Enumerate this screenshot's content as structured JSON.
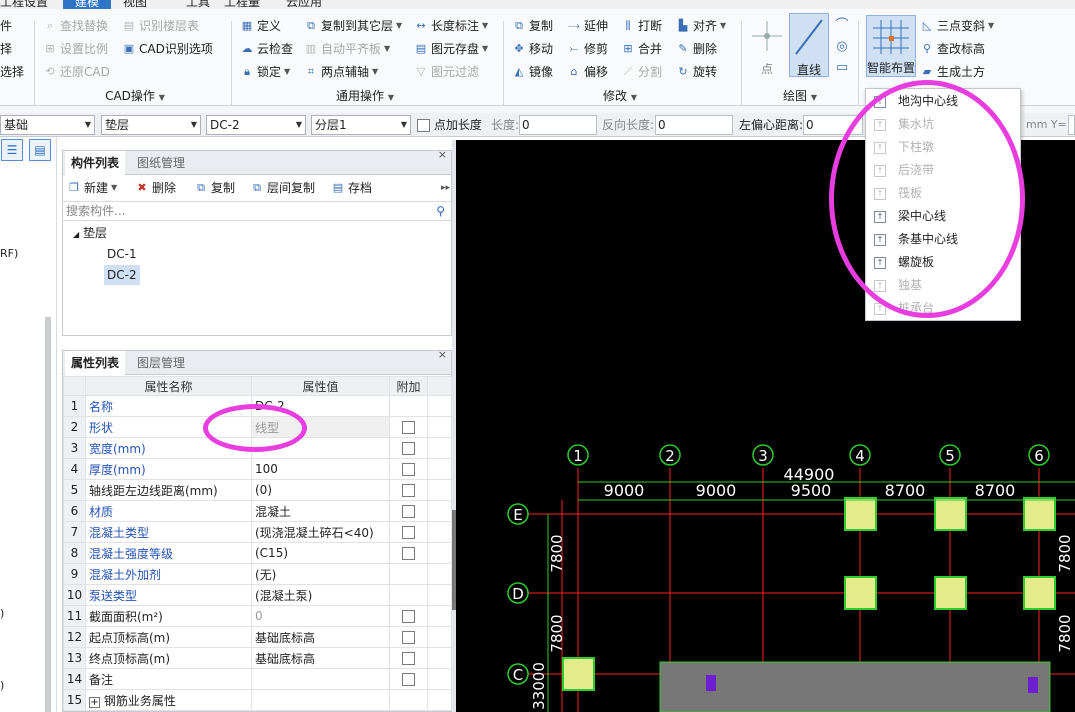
{
  "menu": {
    "tabs": [
      "工程设置",
      "建模",
      "视图",
      "工具",
      "工程量",
      "云应用"
    ],
    "active_index": 1
  },
  "left_edge_fragments": [
    "件",
    "择",
    "选择"
  ],
  "cad_group": {
    "title": "CAD操作",
    "items": [
      "查找替换",
      "识别楼层表",
      "设置比例",
      "CAD识别选项",
      "还原CAD"
    ]
  },
  "general_group": {
    "title": "通用操作",
    "items": [
      "定义",
      "复制到其它层",
      "长度标注",
      "云检查",
      "自动平齐板",
      "图元存盘",
      "锁定",
      "两点辅轴",
      "图元过滤"
    ]
  },
  "modify_group": {
    "title": "修改",
    "items": [
      "复制",
      "延伸",
      "打断",
      "对齐",
      "移动",
      "修剪",
      "合并",
      "删除",
      "镜像",
      "偏移",
      "分割",
      "旋转"
    ]
  },
  "draw_group": {
    "title": "绘图",
    "items": [
      "点",
      "直线"
    ]
  },
  "smart_group": {
    "items": [
      "智能布置",
      "三点变斜",
      "查改标高",
      "生成土方"
    ]
  },
  "propbar": {
    "combos": [
      "基础",
      "垫层",
      "DC-2",
      "分层1"
    ],
    "add_length_label": "点加长度",
    "length_label": "长度:",
    "length_value": "0",
    "reverse_label": "反向长度:",
    "reverse_value": "0",
    "left_offset_label": "左偏心距离:",
    "left_offset_value": "0",
    "unit_tail": "mm Y="
  },
  "left_strip_fragments": [
    "RF)",
    ")",
    ")"
  ],
  "component_panel": {
    "tabs": [
      "构件列表",
      "图纸管理"
    ],
    "toolbar": [
      "新建",
      "删除",
      "复制",
      "层间复制",
      "存档"
    ],
    "search_placeholder": "搜索构件...",
    "tree_root": "垫层",
    "tree_items": [
      "DC-1",
      "DC-2"
    ]
  },
  "property_panel": {
    "tabs": [
      "属性列表",
      "图层管理"
    ],
    "headers": [
      "属性名称",
      "属性值",
      "附加"
    ],
    "rows": [
      {
        "no": "1",
        "name": "名称",
        "value": "DC-2"
      },
      {
        "no": "2",
        "name": "形状",
        "value": "线型"
      },
      {
        "no": "3",
        "name": "宽度(mm)",
        "value": ""
      },
      {
        "no": "4",
        "name": "厚度(mm)",
        "value": "100"
      },
      {
        "no": "5",
        "name": "轴线距左边线距离(mm)",
        "value": "(0)"
      },
      {
        "no": "6",
        "name": "材质",
        "value": "混凝土"
      },
      {
        "no": "7",
        "name": "混凝土类型",
        "value": "(现浇混凝土碎石<40)"
      },
      {
        "no": "8",
        "name": "混凝土强度等级",
        "value": "(C15)"
      },
      {
        "no": "9",
        "name": "混凝土外加剂",
        "value": "(无)"
      },
      {
        "no": "10",
        "name": "泵送类型",
        "value": "(混凝土泵)"
      },
      {
        "no": "11",
        "name": "截面面积(m²)",
        "value": "0"
      },
      {
        "no": "12",
        "name": "起点顶标高(m)",
        "value": "基础底标高"
      },
      {
        "no": "13",
        "name": "终点顶标高(m)",
        "value": "基础底标高"
      },
      {
        "no": "14",
        "name": "备注",
        "value": ""
      },
      {
        "no": "15",
        "name": "钢筋业务属性",
        "value": ""
      }
    ]
  },
  "dropdown_menu": {
    "items": [
      {
        "label": "地沟中心线",
        "enabled": true
      },
      {
        "label": "集水坑",
        "enabled": false
      },
      {
        "label": "下柱墩",
        "enabled": false
      },
      {
        "label": "后浇带",
        "enabled": false
      },
      {
        "label": "筏板",
        "enabled": false
      },
      {
        "label": "梁中心线",
        "enabled": true
      },
      {
        "label": "条基中心线",
        "enabled": true
      },
      {
        "label": "螺旋板",
        "enabled": true
      },
      {
        "label": "独基",
        "enabled": false
      },
      {
        "label": "桩承台",
        "enabled": false
      }
    ]
  },
  "drawing": {
    "axis_numbers": [
      "1",
      "2",
      "3",
      "4",
      "5",
      "6"
    ],
    "axis_letters": [
      "E",
      "D",
      "C"
    ],
    "total_width": "44900",
    "spans": [
      "9000",
      "9000",
      "9500",
      "8700",
      "8700"
    ],
    "row_spacing_left": [
      "7800",
      "7800"
    ],
    "total_height": "33000",
    "row_spacing_right": [
      "7800",
      "7800"
    ],
    "colors": {
      "background": "#000000",
      "axis": "#ff2020",
      "bubble": "#2ecc2e",
      "text": "#ffffff",
      "column_fill": "#e4eb8a",
      "column_border": "#2fbf2f",
      "cushion": "#777777",
      "marker": "#6c1fd0"
    }
  },
  "annotation_color": "#e83ee0"
}
